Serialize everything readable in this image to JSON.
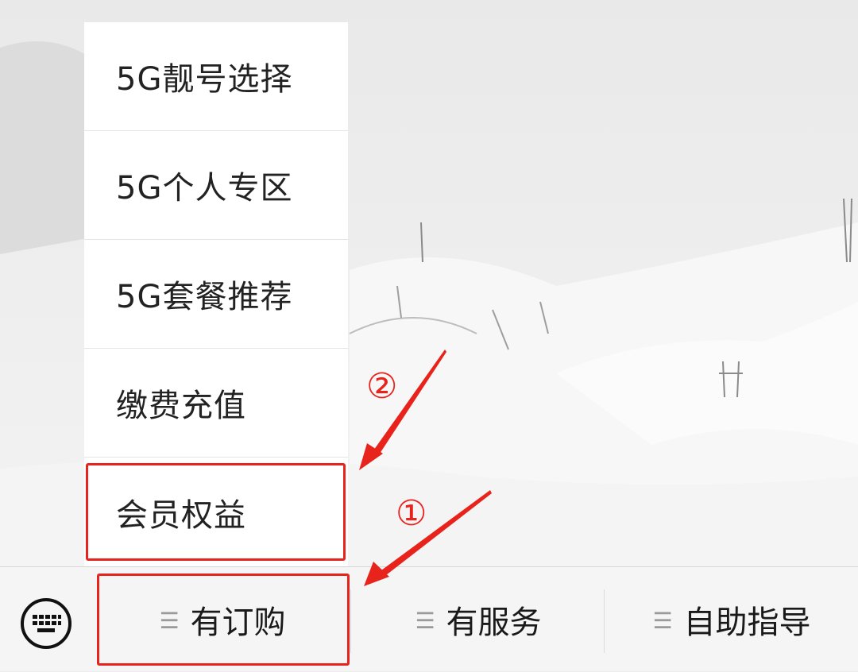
{
  "menu": {
    "items": [
      {
        "label": "5G靓号选择"
      },
      {
        "label": "5G个人专区"
      },
      {
        "label": "5G套餐推荐"
      },
      {
        "label": "缴费充值"
      },
      {
        "label": "会员权益"
      }
    ]
  },
  "bottom_bar": {
    "keyboard_icon": "keyboard-icon",
    "menu_icon": "three-lines-icon",
    "tabs": [
      {
        "label": "有订购"
      },
      {
        "label": "有服务"
      },
      {
        "label": "自助指导"
      }
    ]
  },
  "annotations": {
    "step1": "①",
    "step2": "②",
    "color": "#e8231b"
  }
}
